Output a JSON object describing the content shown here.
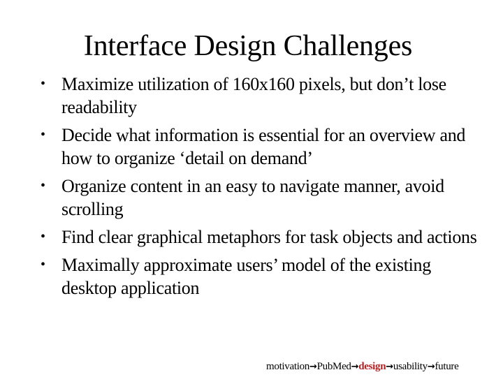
{
  "slide": {
    "title": "Interface Design Challenges",
    "bullet_glyph": "•",
    "bullets": [
      "Maximize utilization of 160x160 pixels, but don’t lose readability",
      "Decide what information is essential for an overview and how to organize ‘detail on demand’",
      "Organize content in an easy to navigate manner, avoid scrolling",
      "Find clear graphical metaphors for task objects and actions",
      "Maximally approximate users’ model of the existing desktop application"
    ]
  },
  "footer_nav": {
    "arrow_glyph": "→",
    "steps": [
      {
        "label": "motivation",
        "current": false
      },
      {
        "label": "PubMed",
        "current": false
      },
      {
        "label": "design",
        "current": true
      },
      {
        "label": "usability",
        "current": false
      },
      {
        "label": "future",
        "current": false
      }
    ],
    "current_color": "#b22222"
  }
}
